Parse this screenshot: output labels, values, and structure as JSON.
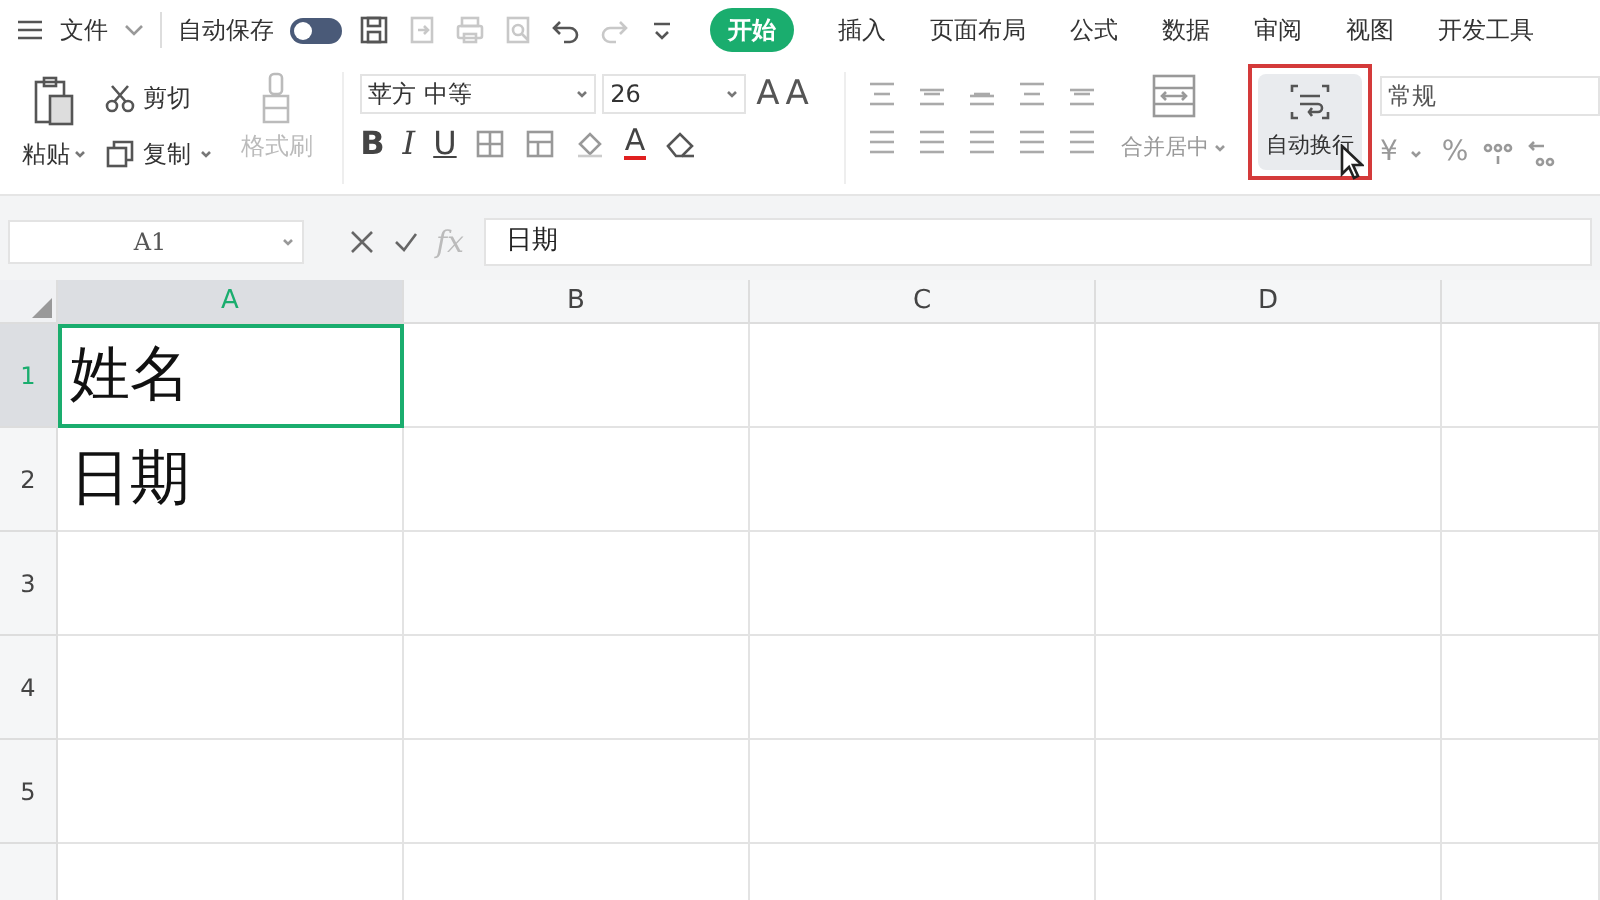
{
  "menu": {
    "label": "文件"
  },
  "autosave": {
    "label": "自动保存",
    "on": false
  },
  "quick_tools": [
    {
      "kind": "save",
      "disabled": false
    },
    {
      "kind": "export",
      "disabled": true
    },
    {
      "kind": "print",
      "disabled": true
    },
    {
      "kind": "preview",
      "disabled": true
    },
    {
      "kind": "undo",
      "disabled": false
    },
    {
      "kind": "redo",
      "disabled": true
    },
    {
      "kind": "more",
      "disabled": false
    }
  ],
  "tabs": [
    {
      "label": "开始",
      "selected": true
    },
    {
      "label": "插入",
      "selected": false
    },
    {
      "label": "页面布局",
      "selected": false
    },
    {
      "label": "公式",
      "selected": false
    },
    {
      "label": "数据",
      "selected": false
    },
    {
      "label": "审阅",
      "selected": false
    },
    {
      "label": "视图",
      "selected": false
    },
    {
      "label": "开发工具",
      "selected": false
    }
  ],
  "ribbon": {
    "paste": "粘贴",
    "cut": "剪切",
    "copy": "复制",
    "format_painter": {
      "label": "格式刷",
      "disabled": true
    },
    "font": "苹方 中等",
    "font_size": "26",
    "grow_font": "A",
    "shrink_font": "A",
    "font_styles": [
      "B",
      "I",
      "U"
    ],
    "font_color": "A",
    "merge": "合并居中",
    "wrap_text": {
      "label": "自动换行",
      "highlighted": true
    },
    "number_format": "常规",
    "currency": "¥",
    "percent": "%"
  },
  "name_box": "A1",
  "fx": "fx",
  "formula": "日期",
  "columns": [
    {
      "label": "A",
      "selected": true
    },
    {
      "label": "B",
      "selected": false
    },
    {
      "label": "C",
      "selected": false
    },
    {
      "label": "D",
      "selected": false
    }
  ],
  "rows": [
    {
      "label": "1",
      "selected": true,
      "cells": [
        {
          "text": "姓名",
          "selected": true
        }
      ]
    },
    {
      "label": "2",
      "selected": false,
      "cells": [
        {
          "text": "日期",
          "selected": false
        }
      ]
    },
    {
      "label": "3",
      "selected": false
    },
    {
      "label": "4",
      "selected": false
    },
    {
      "label": "5",
      "selected": false
    },
    {
      "selected": false
    }
  ]
}
